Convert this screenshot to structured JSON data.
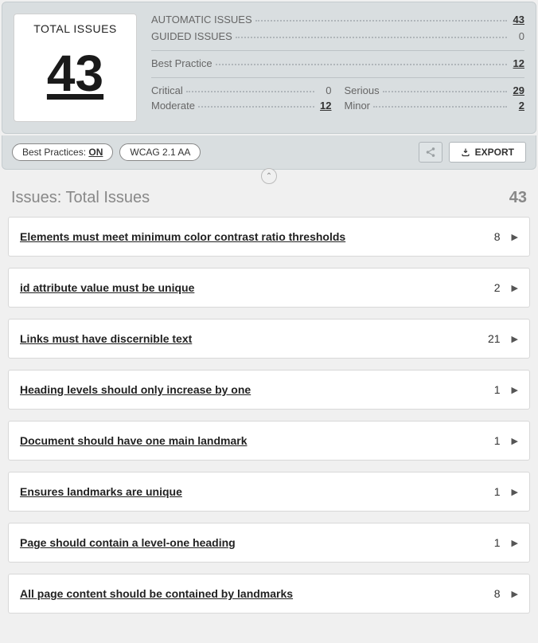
{
  "summary": {
    "total_label": "TOTAL ISSUES",
    "total_value": "43",
    "automatic_label": "AUTOMATIC ISSUES",
    "automatic_value": "43",
    "guided_label": "GUIDED ISSUES",
    "guided_value": "0",
    "best_practice_label": "Best Practice",
    "best_practice_value": "12",
    "critical_label": "Critical",
    "critical_value": "0",
    "serious_label": "Serious",
    "serious_value": "29",
    "moderate_label": "Moderate",
    "moderate_value": "12",
    "minor_label": "Minor",
    "minor_value": "2"
  },
  "toolbar": {
    "best_practices_label": "Best Practices: ",
    "best_practices_state": "ON",
    "wcag_label": "WCAG 2.1 AA",
    "export_label": "EXPORT"
  },
  "issues": {
    "header_title": "Issues: Total Issues",
    "header_count": "43",
    "items": [
      {
        "name": "Elements must meet minimum color contrast ratio thresholds",
        "count": "8"
      },
      {
        "name": "id attribute value must be unique",
        "count": "2"
      },
      {
        "name": "Links must have discernible text",
        "count": "21"
      },
      {
        "name": "Heading levels should only increase by one",
        "count": "1"
      },
      {
        "name": "Document should have one main landmark",
        "count": "1"
      },
      {
        "name": "Ensures landmarks are unique",
        "count": "1"
      },
      {
        "name": "Page should contain a level-one heading",
        "count": "1"
      },
      {
        "name": "All page content should be contained by landmarks",
        "count": "8"
      }
    ]
  }
}
